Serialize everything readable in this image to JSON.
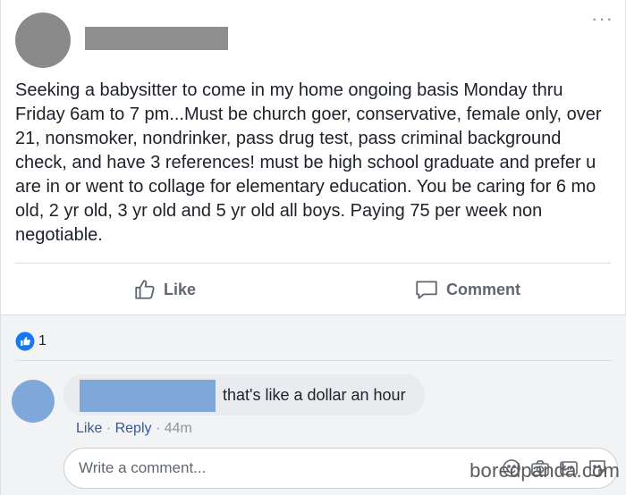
{
  "post": {
    "text": "Seeking a babysitter to come in my home ongoing basis Monday thru Friday 6am to 7 pm...Must be church goer, conservative, female only, over 21, nonsmoker, nondrinker, pass drug test, pass criminal background check, and have 3 references! must be high school graduate and prefer u are in or went to collage for elementary education. You be caring for 6 mo old, 2 yr old, 3 yr old and 5 yr old all boys. Paying 75 per week non negotiable."
  },
  "actions": {
    "like_label": "Like",
    "comment_label": "Comment"
  },
  "reactions": {
    "count": "1"
  },
  "comment": {
    "text": "that's like a dollar an hour",
    "like_label": "Like",
    "reply_label": "Reply",
    "separator": "·",
    "time": "44m"
  },
  "composer": {
    "placeholder": "Write a comment..."
  },
  "watermark": {
    "text": "boredpanda.com"
  },
  "colors": {
    "accent": "#385898",
    "like_blue": "#1877f2",
    "redaction_gray": "#8e8e8e",
    "redaction_blue": "#7fa7d9"
  },
  "icons": {
    "like": "thumbs-up-icon",
    "comment": "speech-bubble-icon",
    "reaction": "like-reaction-icon",
    "more": "ellipsis-icon",
    "composer": [
      "emoji-icon",
      "camera-icon",
      "gif-icon",
      "sticker-icon"
    ]
  }
}
